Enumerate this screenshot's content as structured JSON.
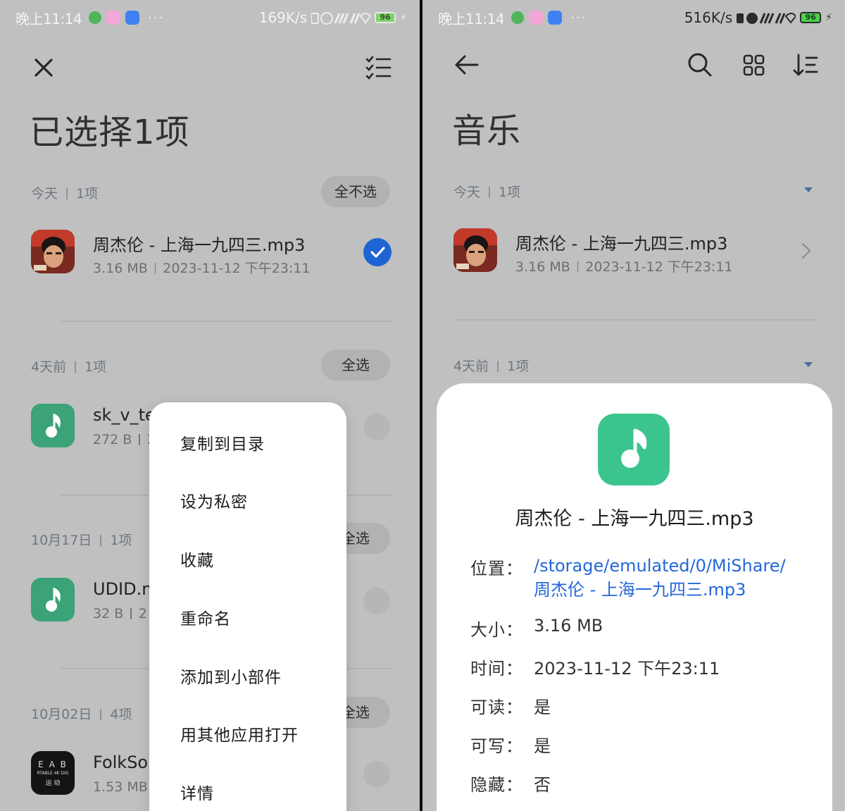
{
  "left": {
    "status": {
      "time": "晚上11:14",
      "dots": "···",
      "speed": "169K/s",
      "battery": "96"
    },
    "title": "已选择1项",
    "sections": [
      {
        "label": "今天",
        "count": "1项",
        "action": "全不选"
      },
      {
        "label": "4天前",
        "count": "1项",
        "action": "全选"
      },
      {
        "label": "10月17日",
        "count": "1项",
        "action": "全选"
      },
      {
        "label": "10月02日",
        "count": "4项",
        "action": "全选"
      }
    ],
    "files": [
      {
        "name": "周杰伦 - 上海一九四三.mp3",
        "size": "3.16 MB",
        "date": "2023-11-12 下午23:11",
        "selected": true
      },
      {
        "name": "sk_v_te",
        "size": "272 B",
        "date": "2",
        "selected": false
      },
      {
        "name": "UDID.m",
        "size": "32 B",
        "date": "2",
        "selected": false
      },
      {
        "name": "FolkSo",
        "size": "1.53 MB",
        "date": "",
        "selected": false
      }
    ],
    "thumb_text": {
      "line1": "E A B",
      "line2": "RTABLE 4K DIG",
      "line3": "运  动"
    },
    "menu": [
      "复制到目录",
      "设为私密",
      "收藏",
      "重命名",
      "添加到小部件",
      "用其他应用打开",
      "详情"
    ]
  },
  "right": {
    "status": {
      "time": "晚上11:14",
      "dots": "···",
      "speed": "516K/s",
      "battery": "96"
    },
    "title": "音乐",
    "sections": [
      {
        "label": "今天",
        "count": "1项"
      },
      {
        "label": "4天前",
        "count": "1项"
      }
    ],
    "file": {
      "name": "周杰伦 - 上海一九四三.mp3",
      "size": "3.16 MB",
      "date": "2023-11-12 下午23:11"
    },
    "details": {
      "title": "周杰伦 - 上海一九四三.mp3",
      "location_label": "位置：",
      "location_line1": "/storage/emulated/0/MiShare/",
      "location_line2": "周杰伦 - 上海一九四三.mp3",
      "size_label": "大小：",
      "size": "3.16 MB",
      "time_label": "时间：",
      "time": "2023-11-12 下午23:11",
      "readable_label": "可读：",
      "readable": "是",
      "writable_label": "可写：",
      "writable": "是",
      "hidden_label": "隐藏：",
      "hidden": "否"
    }
  },
  "colors": {
    "accent": "#1f64d4",
    "music_green": "#3cc48e",
    "link": "#2468d8",
    "scrim": "#c0c0c0"
  }
}
